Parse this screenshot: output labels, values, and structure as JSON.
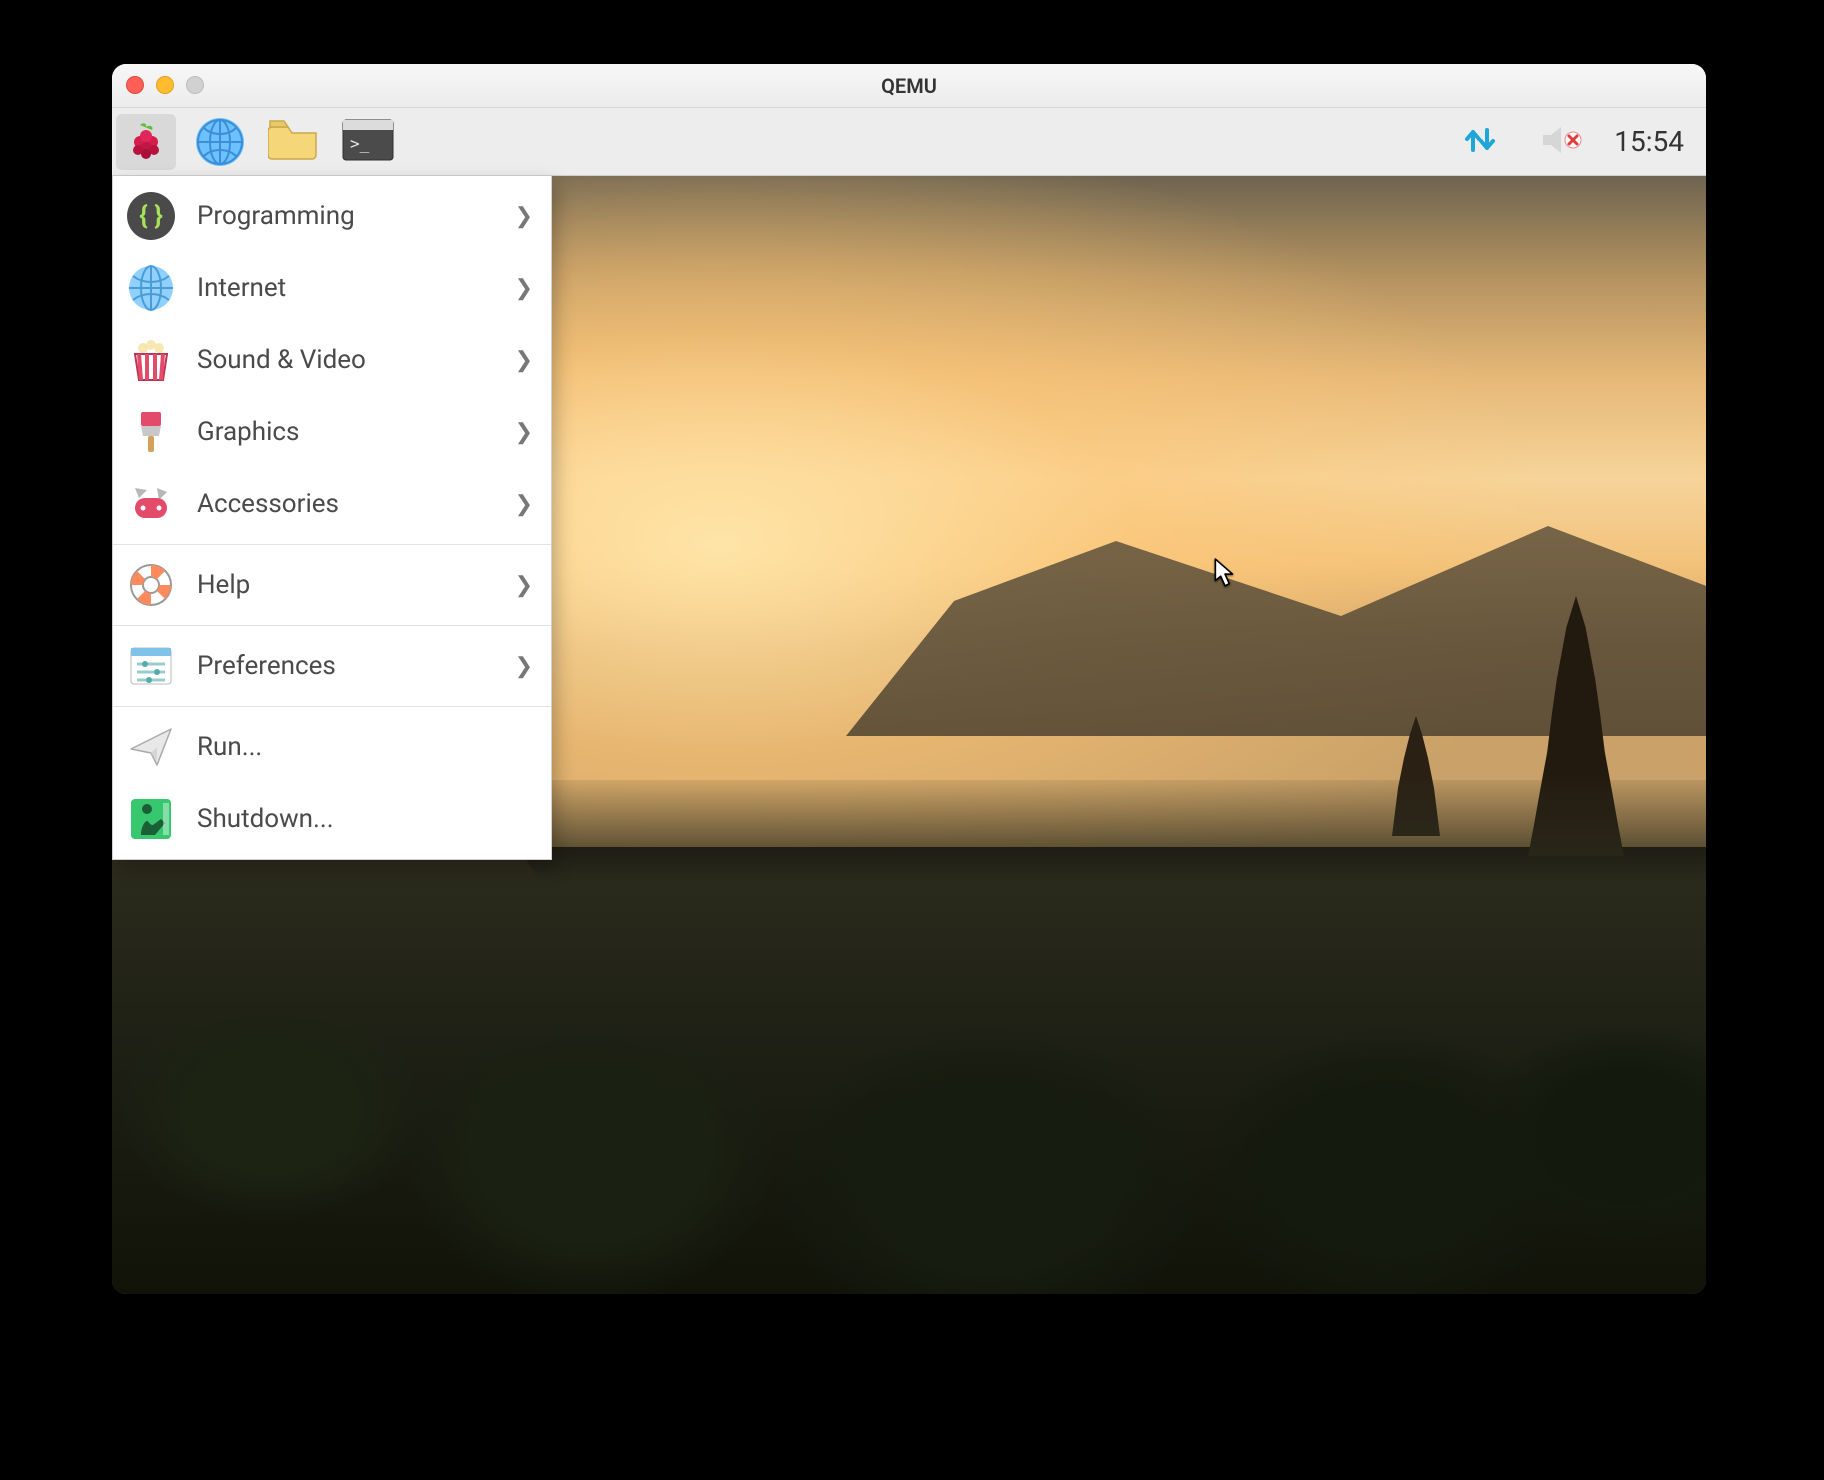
{
  "host_window": {
    "title": "QEMU"
  },
  "panel": {
    "clock": "15:54",
    "launchers": {
      "menu": "raspberry-menu",
      "browser": "web-browser",
      "files": "file-manager",
      "terminal": "terminal"
    },
    "tray": {
      "network": "network-updown",
      "volume": "volume-muted"
    }
  },
  "appmenu": {
    "items": [
      {
        "id": "programming",
        "label": "Programming",
        "icon": "braces-icon",
        "submenu": true
      },
      {
        "id": "internet",
        "label": "Internet",
        "icon": "globe-icon",
        "submenu": true
      },
      {
        "id": "sound-video",
        "label": "Sound & Video",
        "icon": "popcorn-icon",
        "submenu": true
      },
      {
        "id": "graphics",
        "label": "Graphics",
        "icon": "paintbrush-icon",
        "submenu": true
      },
      {
        "id": "accessories",
        "label": "Accessories",
        "icon": "swissknife-icon",
        "submenu": true
      }
    ],
    "items2": [
      {
        "id": "help",
        "label": "Help",
        "icon": "lifering-icon",
        "submenu": true
      }
    ],
    "items3": [
      {
        "id": "preferences",
        "label": "Preferences",
        "icon": "sliders-icon",
        "submenu": true
      }
    ],
    "items4": [
      {
        "id": "run",
        "label": "Run...",
        "icon": "paperplane-icon",
        "submenu": false
      },
      {
        "id": "shutdown",
        "label": "Shutdown...",
        "icon": "exit-icon",
        "submenu": false
      }
    ]
  }
}
